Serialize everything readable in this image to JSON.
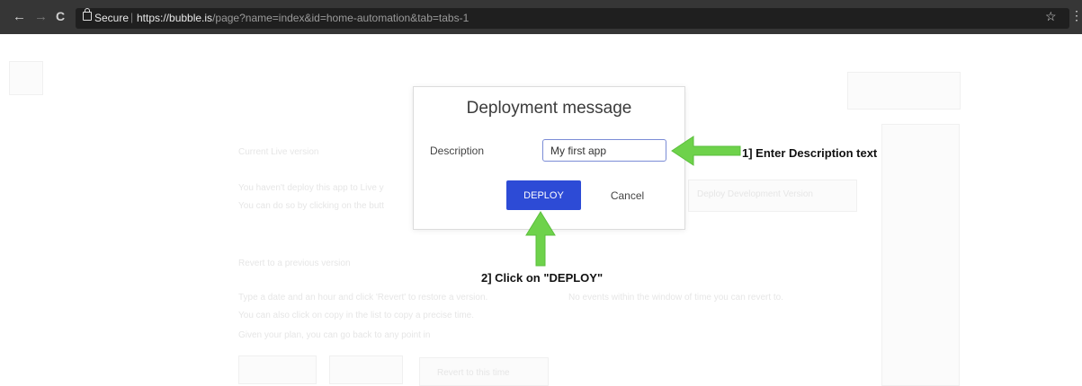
{
  "browser": {
    "secure_label": "Secure",
    "url_host": "https://bubble.is",
    "url_path": "/page?name=index&id=home-automation&tab=tabs-1",
    "back_icon": "←",
    "forward_icon": "→",
    "reload_icon": "C",
    "star_icon": "☆",
    "menu_icon": "⋮"
  },
  "modal": {
    "title": "Deployment message",
    "description_label": "Description",
    "description_value": "My first app",
    "deploy_label": "DEPLOY",
    "cancel_label": "Cancel",
    "accent_color": "#2d4bd6"
  },
  "annotations": {
    "step1": "1] Enter Description text",
    "step2": "2] Click on \"DEPLOY\"",
    "arrow_color": "#6ed24b"
  },
  "background": {
    "current_live_version": "Current Live version",
    "deploy_line1": "You haven't deploy this app to Live y",
    "deploy_line2": "You can do so by clicking on the butt",
    "deploy_dev_button": "Deploy Development Version",
    "revert_heading": "Revert to a previous version",
    "revert_line1": "Type a date and an hour and click 'Revert' to restore a version.",
    "revert_line2": "You can also click on copy in the list to copy a precise time.",
    "revert_line3": "Given your plan, you can go back to any point in",
    "no_events": "No events within the window of time you can revert to.",
    "revert_button": "Revert to this time"
  }
}
